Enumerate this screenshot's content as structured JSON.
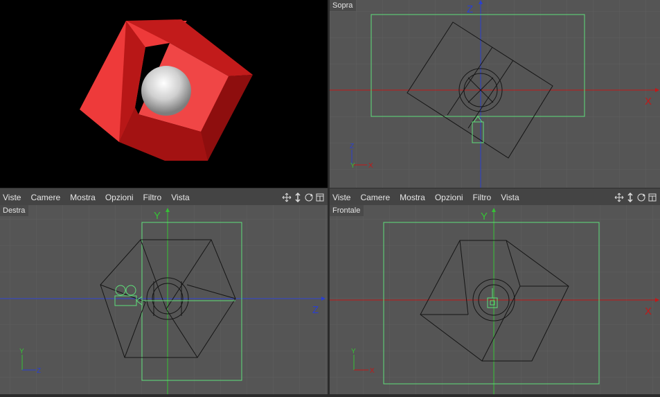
{
  "viewports": {
    "perspective": {
      "name": ""
    },
    "top": {
      "label": "Sopra",
      "axis_h": "X",
      "axis_v": "Z",
      "gizmo_v": "Z",
      "gizmo_h1": "Y",
      "gizmo_h2": "X"
    },
    "right": {
      "label": "Destra",
      "axis_h": "Z",
      "axis_v": "Y",
      "gizmo_v": "Y",
      "gizmo_h": "Z"
    },
    "front": {
      "label": "Frontale",
      "axis_h": "X",
      "axis_v": "Y",
      "gizmo_v": "Y",
      "gizmo_h": "X"
    }
  },
  "menubar_left": {
    "items": [
      "Viste",
      "Camere",
      "Mostra",
      "Opzioni",
      "Filtro",
      "Vista"
    ]
  },
  "menubar_right": {
    "items": [
      "Viste",
      "Camere",
      "Mostra",
      "Opzioni",
      "Filtro",
      "Vista"
    ]
  },
  "nav_icons": [
    "move-icon",
    "dolly-icon",
    "rotate-icon",
    "maximize-icon"
  ],
  "colors": {
    "grid_bg": "#555555",
    "grid_line": "#5e5e5e",
    "axis_x": "#c21818",
    "axis_y": "#35c235",
    "axis_z": "#2a3fd0",
    "safe_frame": "#5fe07a",
    "cube_red": "#e73030",
    "sphere": "#d8d8d8"
  }
}
